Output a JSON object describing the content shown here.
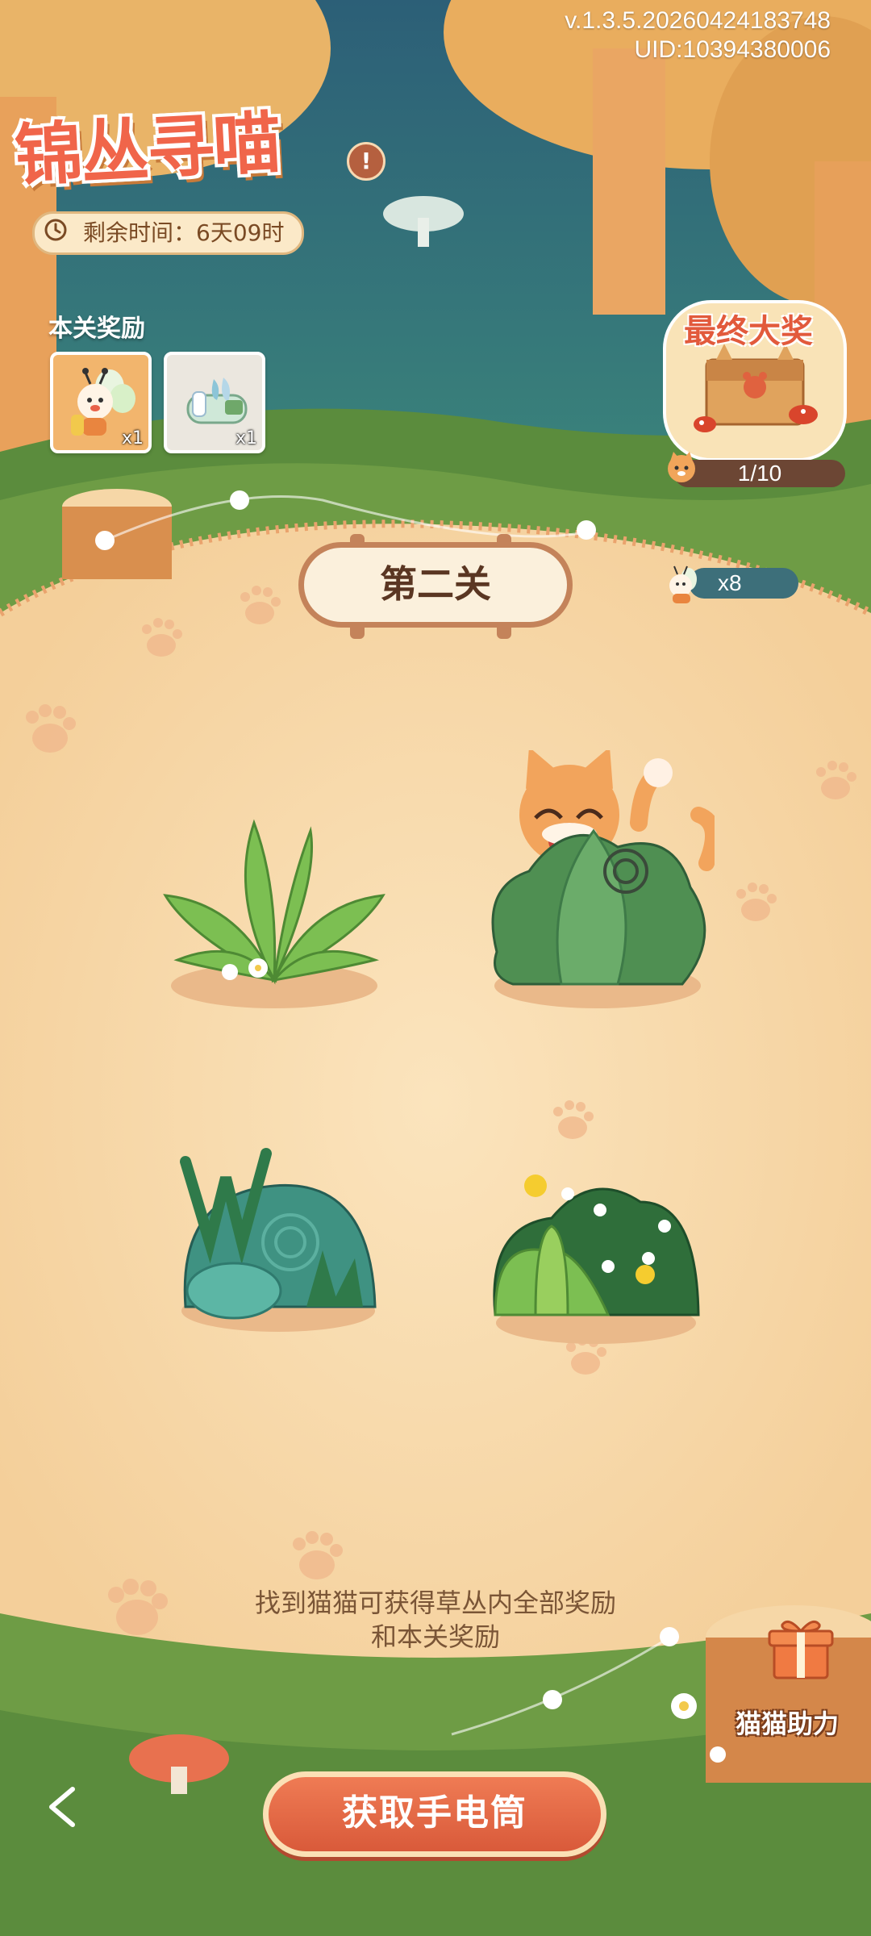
{
  "version": {
    "line1": "v.1.3.5.20260424183748",
    "line2": "UID:10394380006"
  },
  "event": {
    "title": "锦丛寻喵",
    "timer_label": "剩余时间：6天09时"
  },
  "rewards": {
    "title": "本关奖励",
    "items": [
      {
        "icon": "bee-character-icon",
        "qty": "x1"
      },
      {
        "icon": "paint-tubes-icon",
        "qty": "x1"
      }
    ]
  },
  "grand_prize": {
    "title": "最终大奖",
    "progress": "1/10"
  },
  "bee_counter": "x8",
  "level_label": "第二关",
  "bushes": [
    {
      "id": "fern-bush",
      "revealed_cat": false
    },
    {
      "id": "dark-green-bush",
      "revealed_cat": true
    },
    {
      "id": "teal-rock-bush",
      "revealed_cat": false
    },
    {
      "id": "flower-bush",
      "revealed_cat": false
    }
  ],
  "hint": {
    "line1": "找到猫猫可获得草丛内全部奖励",
    "line2": "和本关奖励"
  },
  "helper": {
    "label": "猫猫助力"
  },
  "buttons": {
    "get_flashlight": "获取手电筒"
  },
  "colors": {
    "accent": "#e0623f",
    "path": "#f2dcb4",
    "grass": "#5d8f3f",
    "water": "#2f6e80"
  }
}
